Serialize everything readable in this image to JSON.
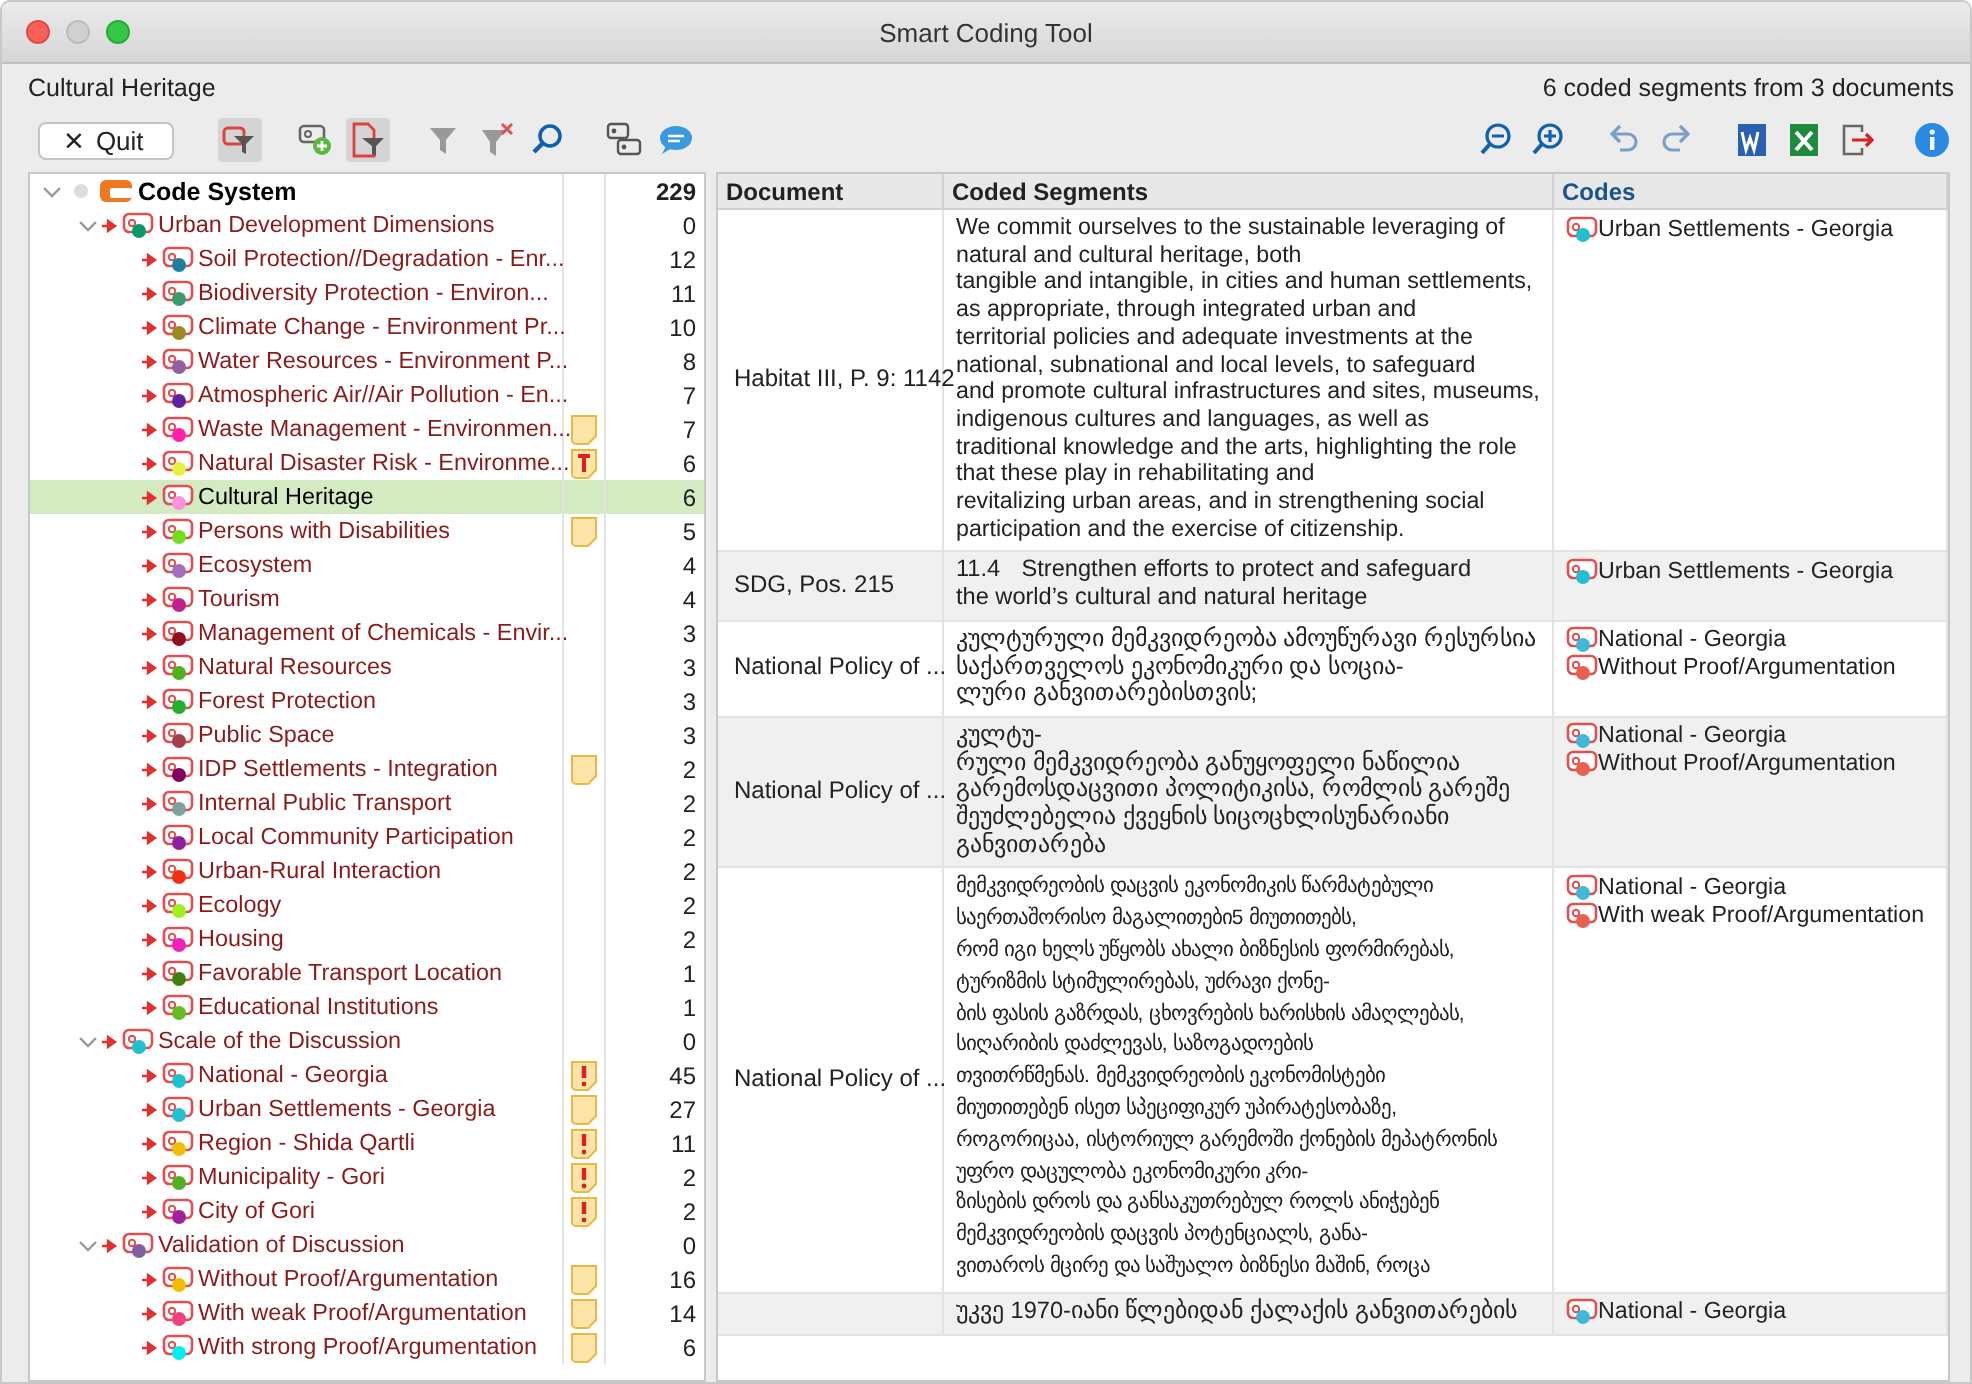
{
  "window": {
    "title": "Smart Coding Tool"
  },
  "info": {
    "selection": "Cultural Heritage",
    "summary": "6 coded segments from 3 documents"
  },
  "toolbar_left": [
    {
      "kind": "quit",
      "label": "Quit",
      "icon": "×",
      "active": false
    },
    {
      "kind": "code-filter",
      "active": true
    },
    {
      "kind": "new-code",
      "active": false
    },
    {
      "kind": "doc-filter",
      "active": true
    },
    {
      "kind": "funnel",
      "active": false
    },
    {
      "kind": "funnel-clear",
      "active": false
    },
    {
      "kind": "search",
      "active": false
    },
    {
      "kind": "tags",
      "active": false
    },
    {
      "kind": "comment",
      "active": false
    }
  ],
  "toolbar_right": [
    {
      "kind": "zoom-out"
    },
    {
      "kind": "zoom-in"
    },
    {
      "kind": "undo"
    },
    {
      "kind": "redo"
    },
    {
      "kind": "word"
    },
    {
      "kind": "excel"
    },
    {
      "kind": "export"
    },
    {
      "kind": "info"
    }
  ],
  "code_system": {
    "label": "Code System",
    "count": "229",
    "expanded": true,
    "children": [
      {
        "label": "Urban Development Dimensions",
        "count": "0",
        "color": "#0a9a6a",
        "selected": false,
        "expanded": true,
        "children": [
          {
            "label": "Soil Protection//Degradation - Enr...",
            "count": "12",
            "color": "#1a7fa0",
            "selected": false
          },
          {
            "label": "Biodiversity Protection - Environ...",
            "count": "11",
            "color": "#3a9a6a",
            "selected": false
          },
          {
            "label": "Climate Change - Environment Pr...",
            "count": "10",
            "color": "#9a8a20",
            "selected": false
          },
          {
            "label": "Water Resources - Environment P...",
            "count": "8",
            "color": "#9060a0",
            "selected": false
          },
          {
            "label": "Atmospheric Air//Air Pollution - En...",
            "count": "7",
            "color": "#6020a0",
            "selected": false
          },
          {
            "label": "Waste Management - Environmen...",
            "count": "7",
            "color": "#ff20b0",
            "memo": {
              "kind": "memo"
            },
            "selected": false
          },
          {
            "label": "Natural Disaster Risk - Environme...",
            "count": "6",
            "color": "#e8f040",
            "memo": {
              "kind": "text"
            },
            "selected": false
          },
          {
            "label": "Cultural Heritage",
            "count": "6",
            "color": "#ff90e0",
            "selected": true
          },
          {
            "label": "Persons with Disabilities",
            "count": "5",
            "color": "#70e020",
            "memo": {
              "kind": "memo"
            },
            "selected": false
          },
          {
            "label": "Ecosystem",
            "count": "4",
            "color": "#a070c0",
            "selected": false
          },
          {
            "label": "Tourism",
            "count": "4",
            "color": "#c02090",
            "selected": false
          },
          {
            "label": "Management of Chemicals - Envir...",
            "count": "3",
            "color": "#901020",
            "selected": false
          },
          {
            "label": "Natural Resources",
            "count": "3",
            "color": "#50b020",
            "selected": false
          },
          {
            "label": "Forest Protection",
            "count": "3",
            "color": "#20b030",
            "selected": false
          },
          {
            "label": "Public Space",
            "count": "3",
            "color": "#a04050",
            "selected": false
          },
          {
            "label": "IDP Settlements - Integration",
            "count": "2",
            "color": "#800060",
            "memo": {
              "kind": "memo"
            },
            "selected": false
          },
          {
            "label": "Internal Public Transport",
            "count": "2",
            "color": "#80a0a0",
            "selected": false
          },
          {
            "label": "Local Community Participation",
            "count": "2",
            "color": "#9020a0",
            "selected": false
          },
          {
            "label": "Urban-Rural Interaction",
            "count": "2",
            "color": "#f03010",
            "selected": false
          },
          {
            "label": "Ecology",
            "count": "2",
            "color": "#a0f020",
            "selected": false
          },
          {
            "label": "Housing",
            "count": "2",
            "color": "#f020c0",
            "selected": false
          },
          {
            "label": "Favorable Transport Location",
            "count": "1",
            "color": "#408010",
            "selected": false
          },
          {
            "label": "Educational Institutions",
            "count": "1",
            "color": "#60c020",
            "selected": false
          }
        ]
      },
      {
        "label": "Scale of the Discussion",
        "count": "0",
        "color": "#20c0d0",
        "selected": false,
        "expanded": true,
        "children": [
          {
            "label": "National - Georgia",
            "count": "45",
            "color": "#20c0d0",
            "memo": {
              "kind": "important"
            },
            "selected": false
          },
          {
            "label": "Urban Settlements - Georgia",
            "count": "27",
            "color": "#20c0d0",
            "memo": {
              "kind": "memo"
            },
            "selected": false
          },
          {
            "label": "Region - Shida Qartli",
            "count": "11",
            "color": "#f0c000",
            "memo": {
              "kind": "important"
            },
            "selected": false
          },
          {
            "label": "Municipality - Gori",
            "count": "2",
            "color": "#50b020",
            "memo": {
              "kind": "important"
            },
            "selected": false
          },
          {
            "label": "City of Gori",
            "count": "2",
            "color": "#a020a0",
            "memo": {
              "kind": "important"
            },
            "selected": false
          }
        ]
      },
      {
        "label": "Validation of Discussion",
        "count": "0",
        "color": "#8060a0",
        "selected": false,
        "expanded": true,
        "children": [
          {
            "label": "Without Proof/Argumentation",
            "count": "16",
            "color": "#f0c000",
            "memo": {
              "kind": "memo"
            },
            "selected": false
          },
          {
            "label": "With weak Proof/Argumentation",
            "count": "14",
            "color": "#f04080",
            "memo": {
              "kind": "memo"
            },
            "selected": false
          },
          {
            "label": "With strong Proof/Argumentation",
            "count": "6",
            "color": "#00f0f0",
            "memo": {
              "kind": "memo"
            },
            "selected": false
          }
        ]
      }
    ]
  },
  "table": {
    "columns": [
      {
        "label": "Document",
        "sorted": false
      },
      {
        "label": "Coded Segments",
        "sorted": false
      },
      {
        "label": "Codes",
        "sorted": true
      }
    ],
    "rows": [
      {
        "document": "Habitat III, P. 9: 1142",
        "segment": "We commit ourselves to the sustainable leveraging of\nnatural and cultural heritage, both\ntangible and intangible, in cities and human settlements,\nas appropriate, through integrated urban and\nterritorial policies and adequate investments at the\nnational, subnational and local levels, to safeguard\nand promote cultural infrastructures and sites, museums,\nindigenous cultures and languages, as well as\ntraditional knowledge and the arts, highlighting the role\nthat these play in rehabilitating and\nrevitalizing urban areas, and in strengthening social\nparticipation and the exercise of citizenship.",
        "codes": [
          {
            "label": "Urban Settlements - Georgia",
            "color": "#20c0d0"
          }
        ]
      },
      {
        "document": "SDG, Pos. 215",
        "segment": "11.4\tStrengthen efforts to protect and safeguard\nthe world’s cultural and natural heritage",
        "codes": [
          {
            "label": "Urban Settlements - Georgia",
            "color": "#20c0d0"
          }
        ]
      },
      {
        "document": "National Policy of ...",
        "segment": "კულტურული მემკვიდრეობა ამოუწურავი რესურსია\nსაქართველოს ეკონომიკური და სოცია-\nლური განვითარებისთვის;",
        "codes": [
          {
            "label": "National - Georgia",
            "color": "#40b8d8"
          },
          {
            "label": "Without Proof/Argumentation",
            "color": "#e86050"
          }
        ]
      },
      {
        "document": "National Policy of ...",
        "segment": "კულტუ-\nრული მემკვიდრეობა განუყოფელი ნაწილია\nგარემოსდაცვითი პოლიტიკისა, რომლის გარეშე\nშეუძლებელია ქვეყნის სიცოცხლისუნარიანი\nგანვითარება",
        "codes": [
          {
            "label": "National - Georgia",
            "color": "#40b8d8"
          },
          {
            "label": "Without Proof/Argumentation",
            "color": "#e86050"
          }
        ]
      },
      {
        "document": "National Policy of ...",
        "segment": "მემკვიდრეობის დაცვის ეკონომიკის წარმატებული\nსაერთაშორისო მაგალითები5 მიუთითებს,\nრომ იგი ხელს უწყობს ახალი ბიზნესის ფორმირებას,\nტურიზმის სტიმულირებას, უძრავი ქონე-\nბის ფასის გაზრდას, ცხოვრების ხარისხის ამაღლებას,\nსიღარიბის დაძლევას, საზოგადოების\nთვითრწმენას. მემკვიდრეობის ეკონომისტები\nმიუთითებენ ისეთ სპეციფიკურ უპირატესობაზე,\nროგორიცაა, ისტორიულ გარემოში ქონების მეპატრონის\nუფრო დაცულობა ეკონომიკური კრი-\nზისების დროს და განსაკუთრებულ როლს ანიჭებენ\nმემკვიდრეობის დაცვის პოტენციალს, განა-\nვითაროს მცირე და საშუალო ბიზნესი მაშინ, როცა",
        "codes": [
          {
            "label": "National - Georgia",
            "color": "#40b8d8"
          },
          {
            "label": "With weak Proof/Argumentation",
            "color": "#e86050"
          }
        ]
      },
      {
        "document": "",
        "segment": "უკვე 1970-იანი წლებიდან ქალაქის განვითარების",
        "codes": [
          {
            "label": "National - Georgia",
            "color": "#40b8d8"
          }
        ]
      }
    ]
  }
}
